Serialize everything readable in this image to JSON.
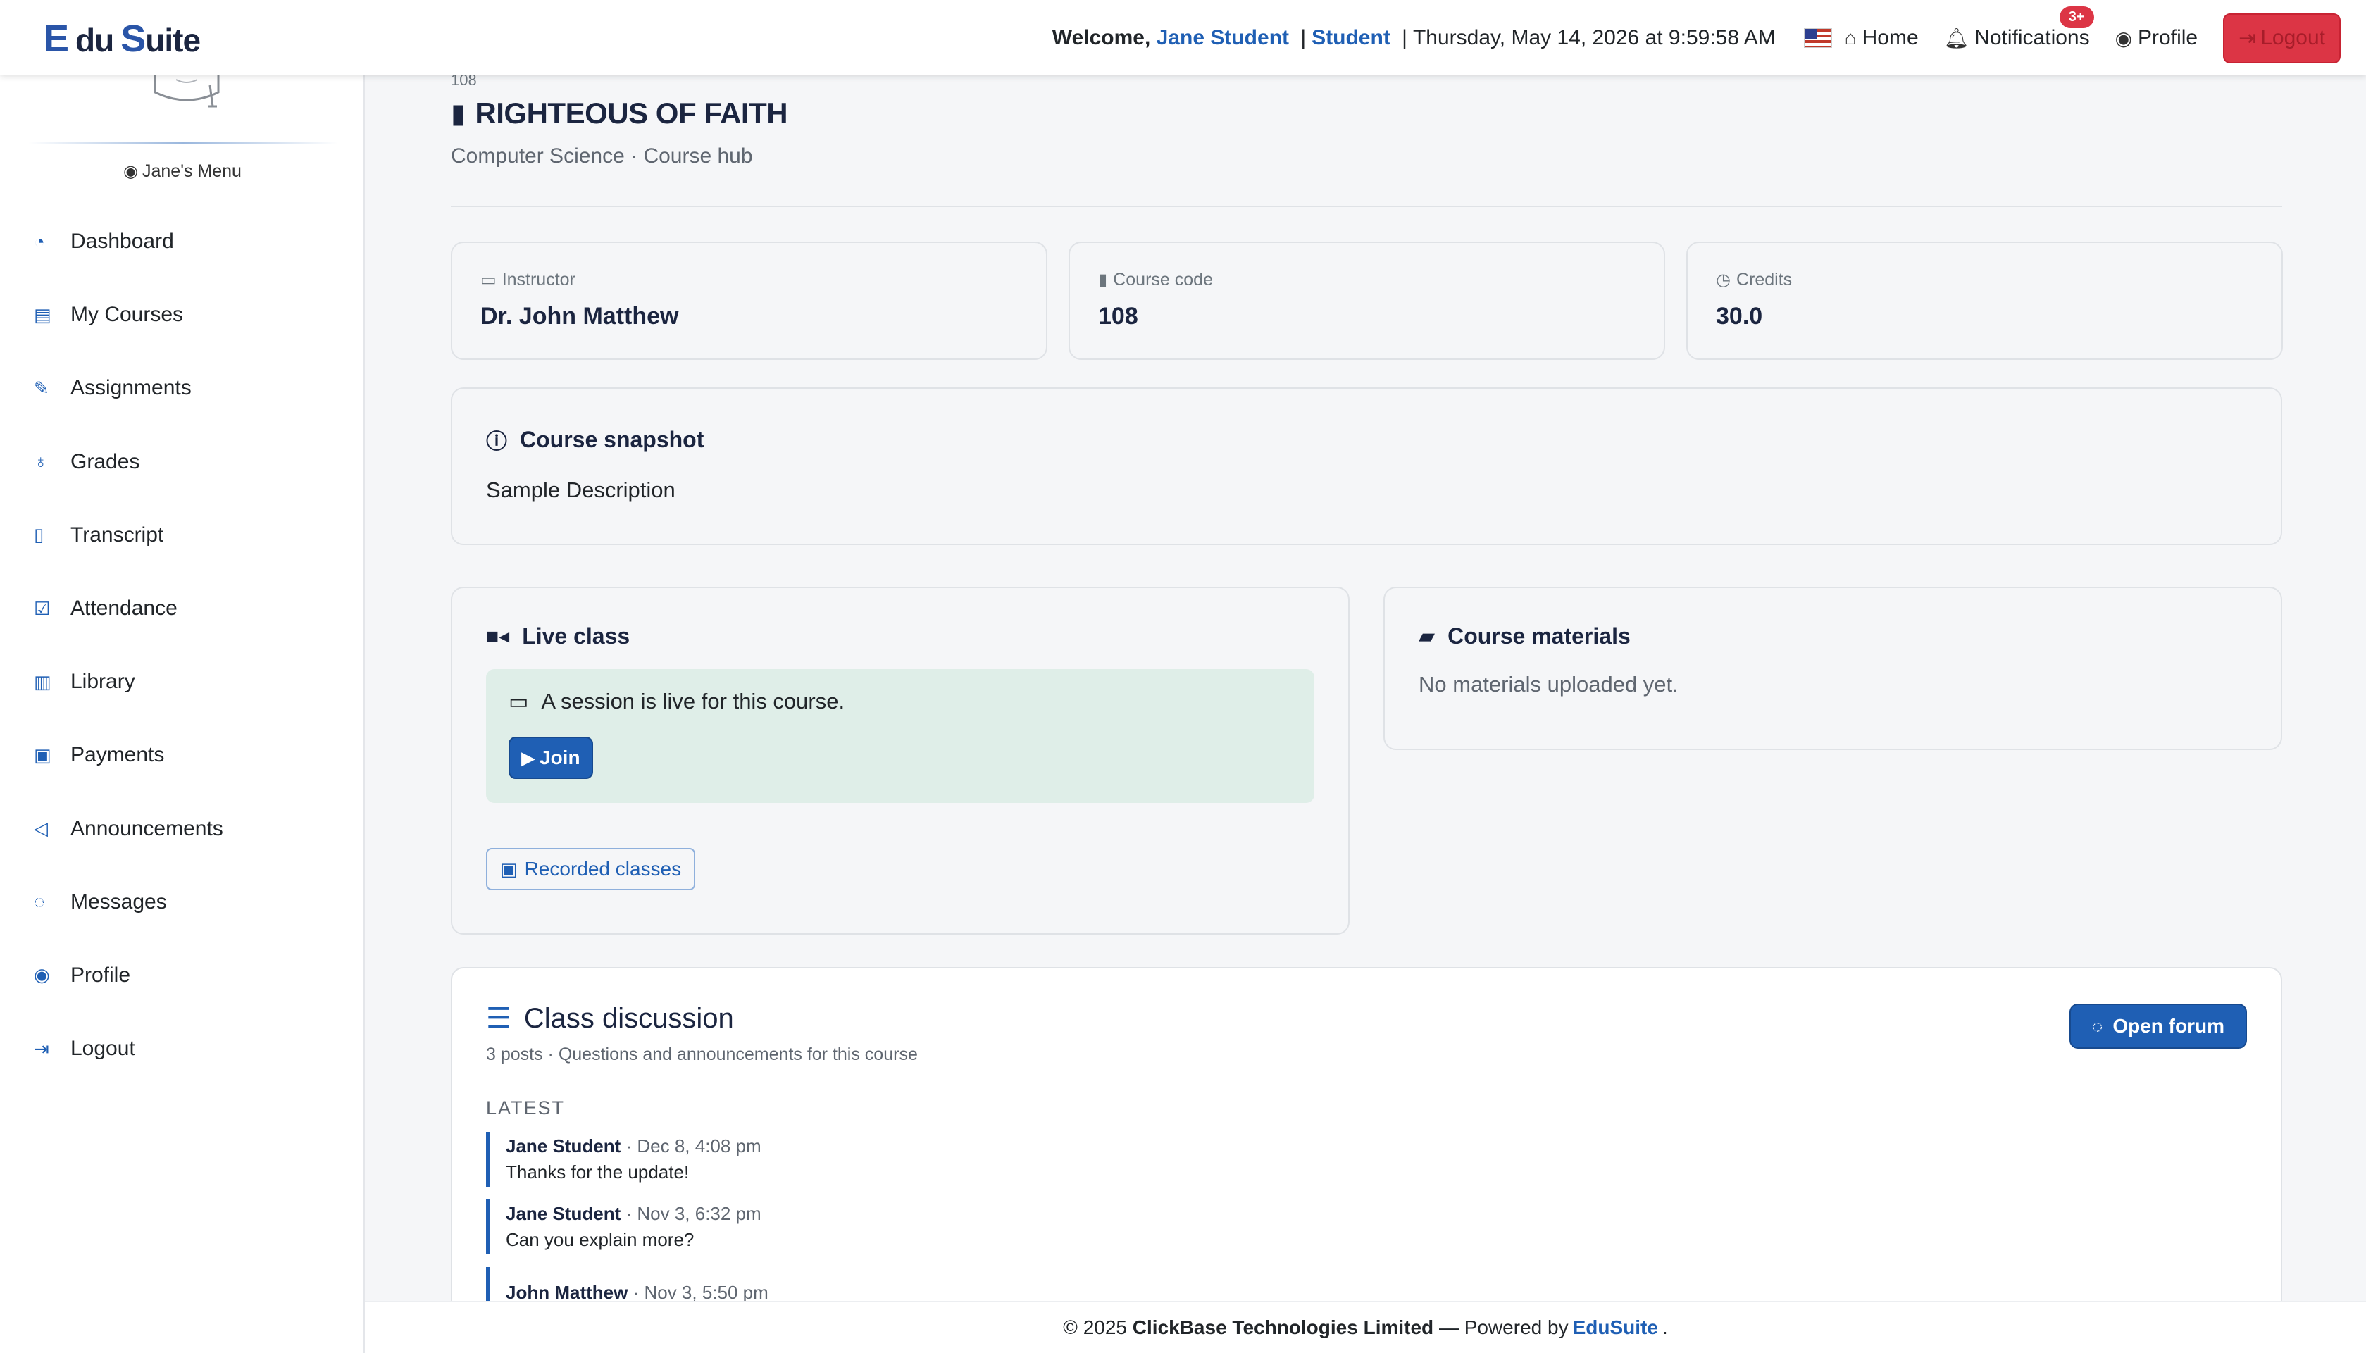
{
  "brand": {
    "e": "E",
    "du": "du",
    "s": "S",
    "uite": "uite"
  },
  "topnav": {
    "welcome_prefix": "Welcome,",
    "user_name": "Jane Student",
    "separator": "|",
    "role": "Student",
    "datetime": "Thursday, May 14, 2026 at 9:59:58 AM",
    "home_label": "Home",
    "notifications_label": "Notifications",
    "notifications_badge": "3+",
    "profile_label": "Profile",
    "logout_label": "Logout"
  },
  "sidebar": {
    "menu_title": "Jane's Menu",
    "items": [
      {
        "label": "Dashboard",
        "icon": "dashboard-icon"
      },
      {
        "label": "My Courses",
        "icon": "book-icon"
      },
      {
        "label": "Assignments",
        "icon": "edit-icon"
      },
      {
        "label": "Grades",
        "icon": "award-icon"
      },
      {
        "label": "Transcript",
        "icon": "document-icon"
      },
      {
        "label": "Attendance",
        "icon": "calendar-check-icon"
      },
      {
        "label": "Library",
        "icon": "open-book-icon"
      },
      {
        "label": "Payments",
        "icon": "cash-icon"
      },
      {
        "label": "Announcements",
        "icon": "megaphone-icon"
      },
      {
        "label": "Messages",
        "icon": "chat-icon"
      },
      {
        "label": "Profile",
        "icon": "person-circle-icon"
      },
      {
        "label": "Logout",
        "icon": "logout-icon"
      }
    ]
  },
  "course": {
    "code_small": "108",
    "title": "RIGHTEOUS OF FAITH",
    "subtitle": "Computer Science · Course hub"
  },
  "stats": {
    "instructor_label": "Instructor",
    "instructor_value": "Dr. John Matthew",
    "code_label": "Course code",
    "code_value": "108",
    "credits_label": "Credits",
    "credits_value": "30.0"
  },
  "snapshot": {
    "title": "Course snapshot",
    "body": "Sample Description"
  },
  "live_class": {
    "title": "Live class",
    "message": "A session is live for this course.",
    "join_label": "Join",
    "recorded_label": "Recorded classes"
  },
  "materials": {
    "title": "Course materials",
    "empty_text": "No materials uploaded yet."
  },
  "discussion": {
    "title": "Class discussion",
    "subtitle": "3 posts · Questions and announcements for this course",
    "open_forum_label": "Open forum",
    "latest_label": "LATEST",
    "posts": [
      {
        "author": "Jane Student",
        "time": "· Dec 8, 4:08 pm",
        "message": "Thanks for the update!"
      },
      {
        "author": "Jane Student",
        "time": "· Nov 3, 6:32 pm",
        "message": "Can you explain more?"
      },
      {
        "author": "John Matthew",
        "time": "· Nov 3, 5:50 pm",
        "message": ""
      }
    ]
  },
  "footer": {
    "copyright": "© 2025",
    "company": "ClickBase Technologies Limited",
    "powered": "— Powered by",
    "product": "EduSuite",
    "end": "."
  },
  "colors": {
    "accent": "#1f5fb4",
    "danger": "#dc3545",
    "live_bg": "#dfeee8",
    "card_bg": "#f5f6f8"
  }
}
